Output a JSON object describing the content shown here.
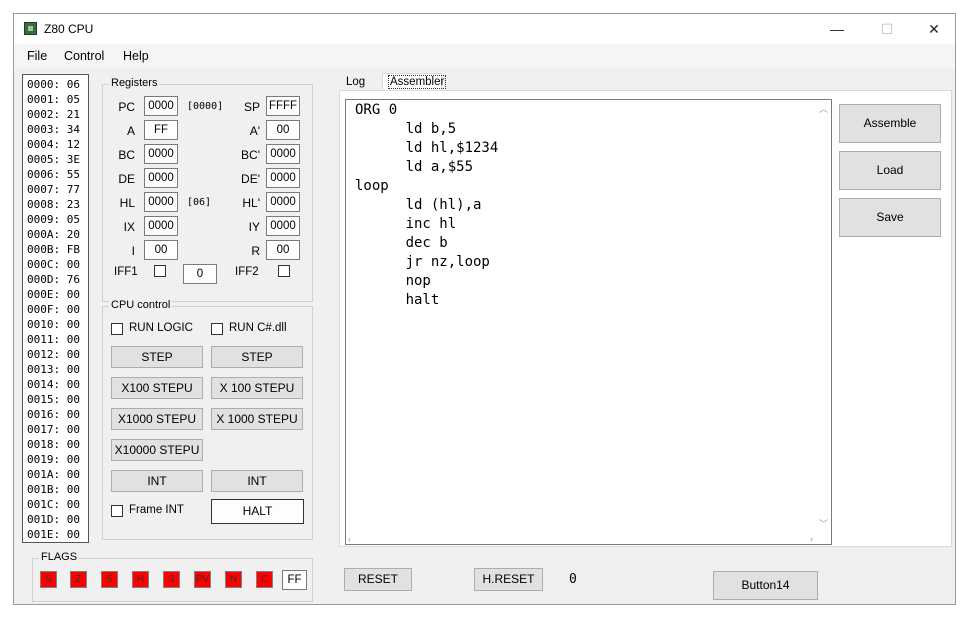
{
  "window": {
    "title": "Z80 CPU",
    "minimize": "—",
    "maximize": "☐",
    "close": "✕"
  },
  "menu": {
    "file": "File",
    "control": "Control",
    "help": "Help"
  },
  "memory": [
    "0000: 06",
    "0001: 05",
    "0002: 21",
    "0003: 34",
    "0004: 12",
    "0005: 3E",
    "0006: 55",
    "0007: 77",
    "0008: 23",
    "0009: 05",
    "000A: 20",
    "000B: FB",
    "000C: 00",
    "000D: 76",
    "000E: 00",
    "000F: 00",
    "0010: 00",
    "0011: 00",
    "0012: 00",
    "0013: 00",
    "0014: 00",
    "0015: 00",
    "0016: 00",
    "0017: 00",
    "0018: 00",
    "0019: 00",
    "001A: 00",
    "001B: 00",
    "001C: 00",
    "001D: 00",
    "001E: 00"
  ],
  "registers": {
    "legend": "Registers",
    "pc_label": "PC",
    "pc": "0000",
    "pc_bracket": "[0000]",
    "sp_label": "SP",
    "sp": "FFFF",
    "a_label": "A",
    "a": "FF",
    "a2_label": "A'",
    "a2": "00",
    "bc_label": "BC",
    "bc": "0000",
    "bc2_label": "BC'",
    "bc2": "0000",
    "de_label": "DE",
    "de": "0000",
    "de2_label": "DE'",
    "de2": "0000",
    "hl_label": "HL",
    "hl": "0000",
    "hl_bracket": "[06]",
    "hl2_label": "HL'",
    "hl2": "0000",
    "ix_label": "IX",
    "ix": "0000",
    "iy_label": "IY",
    "iy": "0000",
    "i_label": "I",
    "i": "00",
    "r_label": "R",
    "r": "00",
    "iff1_label": "IFF1",
    "im": "0",
    "iff2_label": "IFF2"
  },
  "cpu_control": {
    "legend": "CPU control",
    "run_logic": "RUN LOGIC",
    "run_cs": "RUN C#.dll",
    "step_left": "STEP",
    "step_right": "STEP",
    "x100_left": "X100 STEPU",
    "x100_right": "X 100 STEPU",
    "x1000_left": "X1000 STEPU",
    "x1000_right": "X 1000 STEPU",
    "x10000": "X10000 STEPU",
    "int_left": "INT",
    "int_right": "INT",
    "frame_int": "Frame INT",
    "halt": "HALT"
  },
  "flags": {
    "legend": "FLAGS",
    "bits": [
      "S",
      "Z",
      "5",
      "H",
      "3",
      "PV",
      "N",
      "C"
    ],
    "value": "FF",
    "on_color": "#ff0000"
  },
  "tabs": {
    "log": "Log",
    "assembler": "Assembler"
  },
  "editor": {
    "code": "ORG 0\n      ld b,5\n      ld hl,$1234\n      ld a,$55\nloop\n      ld (hl),a\n      inc hl\n      dec b\n      jr nz,loop\n      nop\n      halt"
  },
  "side_buttons": {
    "assemble": "Assemble",
    "load": "Load",
    "save": "Save"
  },
  "bottom": {
    "reset": "RESET",
    "hreset": "H.RESET",
    "counter": "0",
    "button14": "Button14"
  }
}
